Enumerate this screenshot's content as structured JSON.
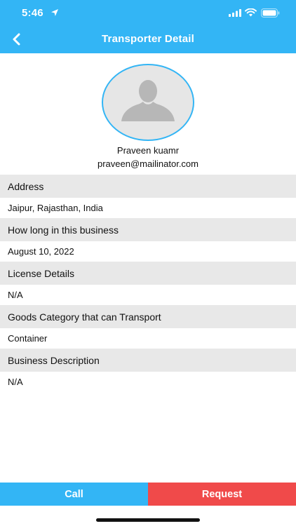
{
  "status_bar": {
    "time": "5:46"
  },
  "nav": {
    "title": "Transporter Detail"
  },
  "profile": {
    "name": "Praveen kuamr",
    "email": "praveen@mailinator.com"
  },
  "details": [
    {
      "label": "Address",
      "value": "Jaipur, Rajasthan, India"
    },
    {
      "label": "How long in this business",
      "value": "August 10, 2022"
    },
    {
      "label": "License Details",
      "value": "N/A"
    },
    {
      "label": "Goods Category that can Transport",
      "value": "Container"
    },
    {
      "label": "Business Description",
      "value": "N/A"
    }
  ],
  "actions": {
    "call_label": "Call",
    "request_label": "Request"
  },
  "colors": {
    "primary": "#33b5f5",
    "danger": "#f04a4a",
    "section_bg": "#e8e8e8"
  },
  "icons": {
    "back": "chevron-left-icon",
    "avatar": "user-silhouette-icon",
    "location": "location-arrow-icon",
    "signal": "cellular-signal-icon",
    "wifi": "wifi-icon",
    "battery": "battery-icon"
  }
}
